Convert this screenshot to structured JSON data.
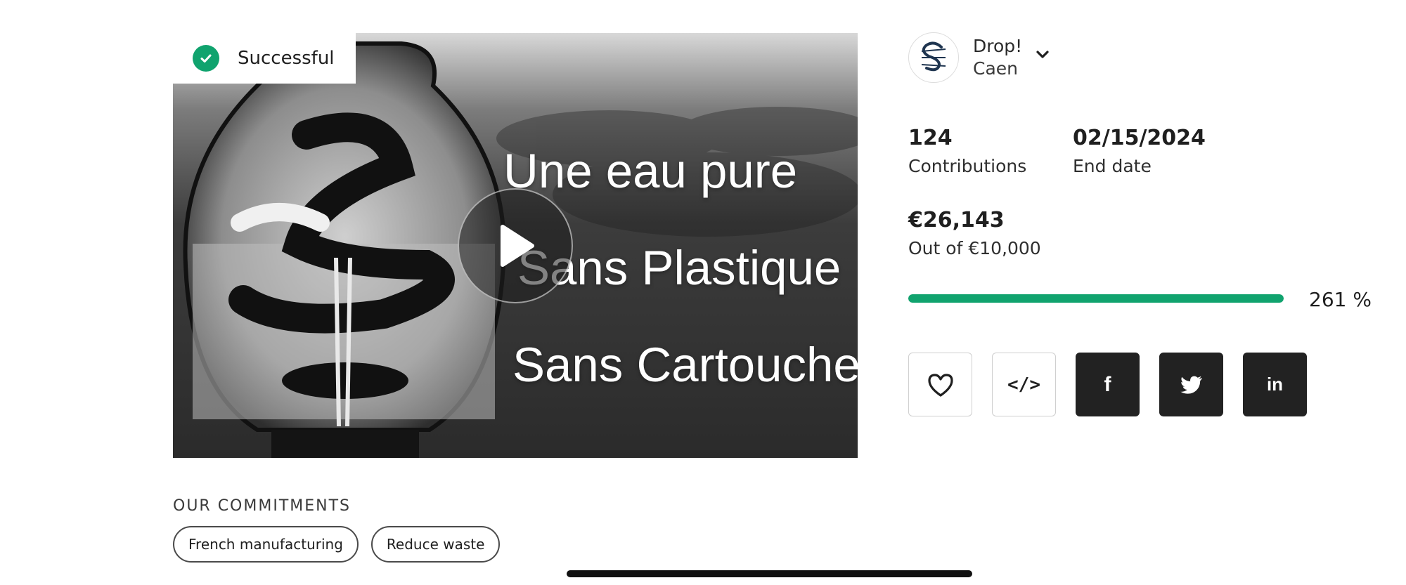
{
  "status": {
    "label": "Successful",
    "icon": "check-circle-icon",
    "color": "#10a36e"
  },
  "video": {
    "lines": [
      "Une eau pure",
      "Sans Plastique",
      "Sans Cartouche"
    ],
    "play_icon": "play-icon"
  },
  "commitments": {
    "title": "OUR COMMITMENTS",
    "tags": [
      "French manufacturing",
      "Reduce waste"
    ]
  },
  "creator": {
    "name": "Drop!",
    "location": "Caen",
    "logo_icon": "drop-s-logo-icon",
    "menu_icon": "chevron-down-icon"
  },
  "stats": {
    "contributions_value": "124",
    "contributions_label": "Contributions",
    "end_date_value": "02/15/2024",
    "end_date_label": "End date",
    "amount_value": "€26,143",
    "goal_label": "Out of €10,000",
    "progress_percent": 100,
    "percent_label": "261 %"
  },
  "actions": [
    "heart-icon",
    "embed-code-icon",
    "facebook-icon",
    "twitter-icon",
    "linkedin-icon"
  ],
  "colors": {
    "accent": "#10a36e",
    "dark_button": "#222222"
  }
}
